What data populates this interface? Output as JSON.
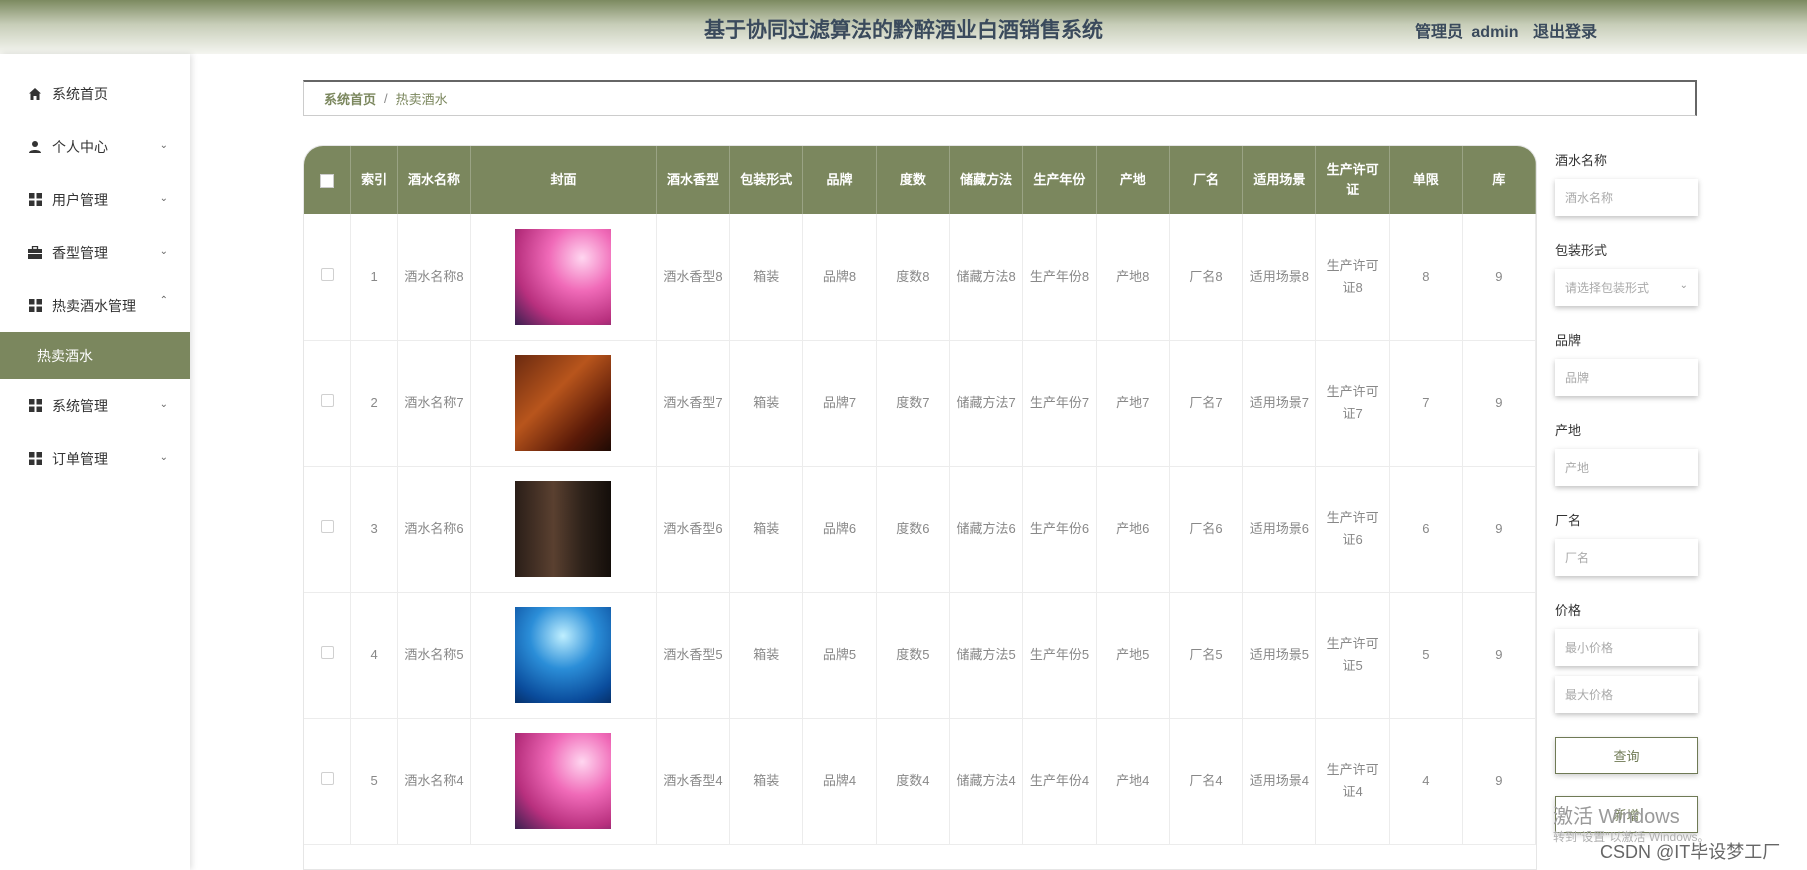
{
  "header": {
    "title": "基于协同过滤算法的黔醉酒业白酒销售系统",
    "user_prefix": "管理员",
    "username": "admin",
    "logout": "退出登录"
  },
  "sidebar": {
    "items": [
      {
        "label": "系统首页",
        "icon": "home-icon",
        "chevron": ""
      },
      {
        "label": "个人中心",
        "icon": "user-icon",
        "chevron": "down"
      },
      {
        "label": "用户管理",
        "icon": "grid-icon",
        "chevron": "down"
      },
      {
        "label": "香型管理",
        "icon": "briefcase-icon",
        "chevron": "down"
      },
      {
        "label": "热卖酒水管理",
        "icon": "grid-icon",
        "chevron": "up"
      },
      {
        "label": "系统管理",
        "icon": "grid-icon",
        "chevron": "down"
      },
      {
        "label": "订单管理",
        "icon": "grid-icon",
        "chevron": "down"
      }
    ],
    "active_sub": "热卖酒水"
  },
  "breadcrumb": {
    "home": "系统首页",
    "sep": "/",
    "current": "热卖酒水"
  },
  "table": {
    "headers": [
      "索引",
      "酒水名称",
      "封面",
      "酒水香型",
      "包装形式",
      "品牌",
      "度数",
      "储藏方法",
      "生产年份",
      "产地",
      "厂名",
      "适用场景",
      "生产许可证",
      "单限",
      "库"
    ],
    "rows": [
      {
        "idx": "1",
        "name": "酒水名称8",
        "cover": "pink-cocktail",
        "aroma": "酒水香型8",
        "pack": "箱装",
        "brand": "品牌8",
        "degree": "度数8",
        "store": "储藏方法8",
        "year": "生产年份8",
        "origin": "产地8",
        "factory": "厂名8",
        "scene": "适用场景8",
        "license": "生产许可证8",
        "limit": "8",
        "stock": "9"
      },
      {
        "idx": "2",
        "name": "酒水名称7",
        "cover": "bottles-amber",
        "aroma": "酒水香型7",
        "pack": "箱装",
        "brand": "品牌7",
        "degree": "度数7",
        "store": "储藏方法7",
        "year": "生产年份7",
        "origin": "产地7",
        "factory": "厂名7",
        "scene": "适用场景7",
        "license": "生产许可证7",
        "limit": "7",
        "stock": "9"
      },
      {
        "idx": "3",
        "name": "酒水名称6",
        "cover": "red-wine-glass",
        "aroma": "酒水香型6",
        "pack": "箱装",
        "brand": "品牌6",
        "degree": "度数6",
        "store": "储藏方法6",
        "year": "生产年份6",
        "origin": "产地6",
        "factory": "厂名6",
        "scene": "适用场景6",
        "license": "生产许可证6",
        "limit": "6",
        "stock": "9"
      },
      {
        "idx": "4",
        "name": "酒水名称5",
        "cover": "blue-cocktail",
        "aroma": "酒水香型5",
        "pack": "箱装",
        "brand": "品牌5",
        "degree": "度数5",
        "store": "储藏方法5",
        "year": "生产年份5",
        "origin": "产地5",
        "factory": "厂名5",
        "scene": "适用场景5",
        "license": "生产许可证5",
        "limit": "5",
        "stock": "9"
      },
      {
        "idx": "5",
        "name": "酒水名称4",
        "cover": "pink-cocktail",
        "aroma": "酒水香型4",
        "pack": "箱装",
        "brand": "品牌4",
        "degree": "度数4",
        "store": "储藏方法4",
        "year": "生产年份4",
        "origin": "产地4",
        "factory": "厂名4",
        "scene": "适用场景4",
        "license": "生产许可证4",
        "limit": "4",
        "stock": "9"
      }
    ]
  },
  "filters": {
    "name_label": "酒水名称",
    "name_placeholder": "酒水名称",
    "pack_label": "包装形式",
    "pack_placeholder": "请选择包装形式",
    "brand_label": "品牌",
    "brand_placeholder": "品牌",
    "origin_label": "产地",
    "origin_placeholder": "产地",
    "factory_label": "厂名",
    "factory_placeholder": "厂名",
    "price_label": "价格",
    "price_min_placeholder": "最小价格",
    "price_max_placeholder": "最大价格",
    "search_button": "查询",
    "add_button": "新增"
  },
  "overlay": {
    "activate_windows": "激活 Windows",
    "activate_hint": "转到\"设置\"以激活 Windows。",
    "csdn": "CSDN @IT毕设梦工厂"
  },
  "colors": {
    "accent": "#7b875e",
    "title": "#3a4a5c"
  }
}
